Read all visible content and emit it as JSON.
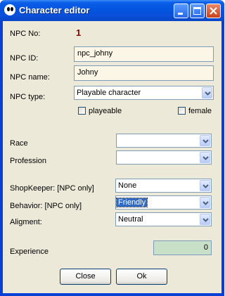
{
  "window": {
    "title": "Character editor"
  },
  "form": {
    "npc_no": {
      "label": "NPC No:",
      "value": "1"
    },
    "npc_id": {
      "label": "NPC ID:",
      "value": "npc_johny"
    },
    "npc_name": {
      "label": "NPC name:",
      "value": "Johny"
    },
    "npc_type": {
      "label": "NPC type:",
      "value": "Playable character"
    },
    "playeable": {
      "label": "playeable",
      "checked": false
    },
    "female": {
      "label": "female",
      "checked": false
    },
    "race": {
      "label": "Race",
      "value": ""
    },
    "profession": {
      "label": "Profession",
      "value": ""
    },
    "shopkeeper": {
      "label": "ShopKeeper: [NPC only]",
      "value": "None"
    },
    "behavior": {
      "label": "Behavior: [NPC only]",
      "value": "Friendly"
    },
    "aligment": {
      "label": "Aligment:",
      "value": "Neutral"
    },
    "experience": {
      "label": "Experience",
      "value": "0"
    }
  },
  "buttons": {
    "close": "Close",
    "ok": "Ok"
  }
}
